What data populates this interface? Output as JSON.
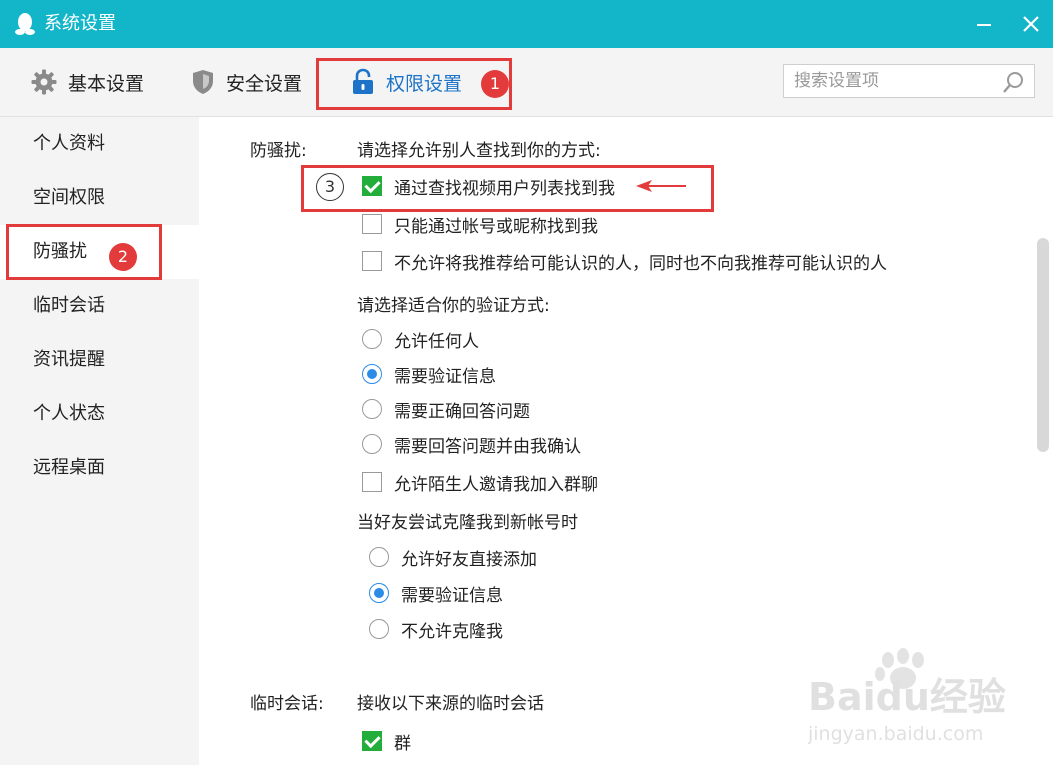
{
  "window": {
    "title": "系统设置",
    "minimize_label": "—",
    "close_label": "✕"
  },
  "tabs": [
    {
      "label": "基本设置",
      "icon": "gear-icon"
    },
    {
      "label": "安全设置",
      "icon": "shield-icon"
    },
    {
      "label": "权限设置",
      "icon": "lock-icon",
      "active": true
    }
  ],
  "search": {
    "placeholder": "搜索设置项",
    "value": ""
  },
  "sidebar": {
    "items": [
      {
        "label": "个人资料"
      },
      {
        "label": "空间权限"
      },
      {
        "label": "防骚扰",
        "active": true
      },
      {
        "label": "临时会话"
      },
      {
        "label": "资讯提醒"
      },
      {
        "label": "个人状态"
      },
      {
        "label": "远程桌面"
      }
    ]
  },
  "anti_harass": {
    "section_label": "防骚扰:",
    "find_prompt": "请选择允许别人查找到你的方式:",
    "find_options": [
      {
        "label": "通过查找视频用户列表找到我",
        "checked": true
      },
      {
        "label": "只能通过帐号或昵称找到我",
        "checked": false
      },
      {
        "label": "不允许将我推荐给可能认识的人，同时也不向我推荐可能认识的人",
        "checked": false
      }
    ],
    "verify_prompt": "请选择适合你的验证方式:",
    "verify_options": [
      {
        "label": "允许任何人",
        "selected": false
      },
      {
        "label": "需要验证信息",
        "selected": true
      },
      {
        "label": "需要正确回答问题",
        "selected": false
      },
      {
        "label": "需要回答问题并由我确认",
        "selected": false
      }
    ],
    "group_invite": {
      "label": "允许陌生人邀请我加入群聊",
      "checked": false
    },
    "clone_prompt": "当好友尝试克隆我到新帐号时",
    "clone_options": [
      {
        "label": "允许好友直接添加",
        "selected": false
      },
      {
        "label": "需要验证信息",
        "selected": true
      },
      {
        "label": "不允许克隆我",
        "selected": false
      }
    ]
  },
  "temp_session": {
    "section_label": "临时会话:",
    "prompt": "接收以下来源的临时会话",
    "options": [
      {
        "label": "群",
        "checked": true
      }
    ]
  },
  "annotations": {
    "badge1": "1",
    "badge2": "2",
    "badge3": "3"
  },
  "colors": {
    "titlebar": "#13b5c9",
    "active_tab": "#1c73c8",
    "checkbox_on": "#23ad3a",
    "radio_on": "#2b8ce8",
    "annotation": "#e33b3b"
  },
  "watermark": {
    "logo_text": "Baidu经验",
    "url_text": "jingyan.baidu.com"
  }
}
